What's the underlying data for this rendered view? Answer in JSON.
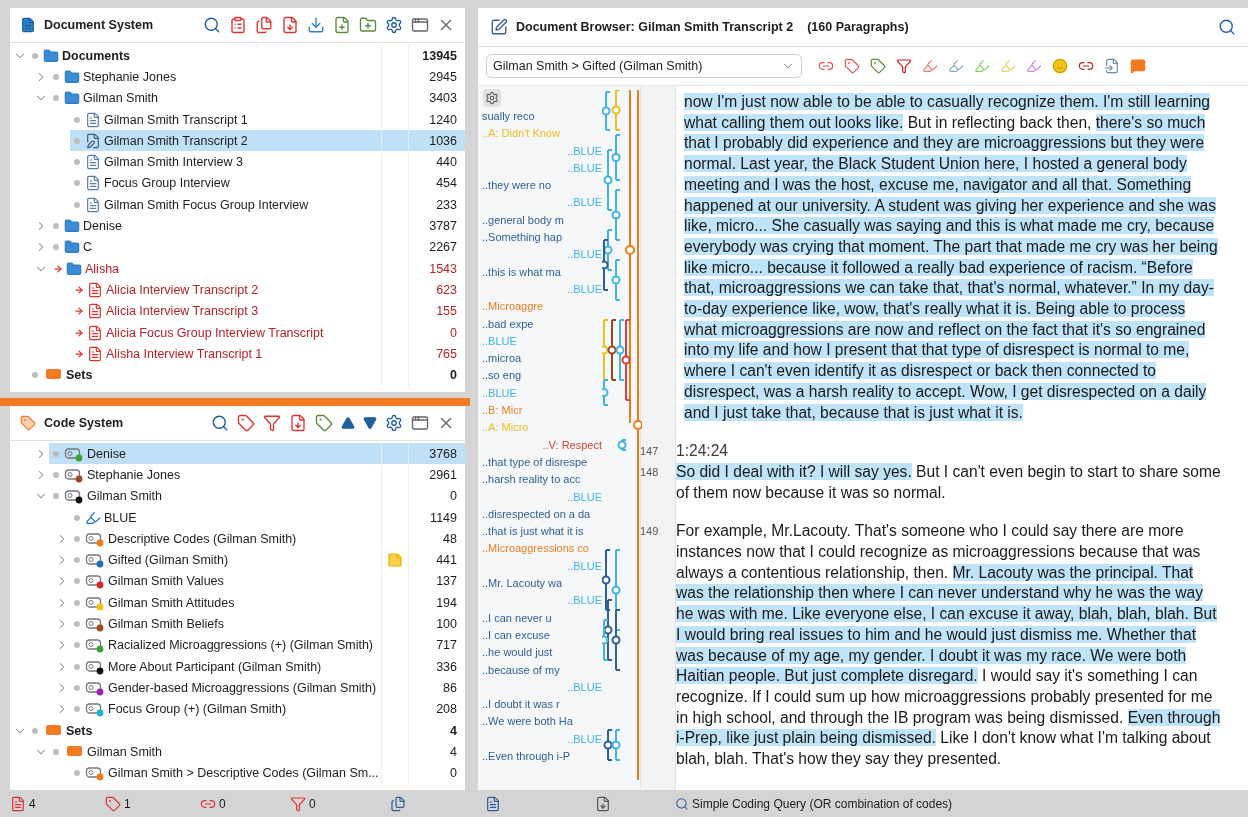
{
  "document_system": {
    "title": "Document System",
    "tree": [
      {
        "label": "Documents",
        "kind": "folder",
        "count": "13945",
        "expanded": true,
        "selected": false,
        "flagged": false,
        "children": [
          {
            "label": "Stephanie Jones",
            "kind": "folder",
            "count": "2945",
            "expanded": false,
            "selected": false,
            "flagged": false
          },
          {
            "label": "Gilman Smith",
            "kind": "folder",
            "count": "3403",
            "expanded": true,
            "selected": false,
            "flagged": false,
            "children": [
              {
                "label": "Gilman Smith Transcript 1",
                "kind": "document",
                "count": "1240",
                "selected": false,
                "flagged": false
              },
              {
                "label": "Gilman Smith Transcript 2",
                "kind": "open-document",
                "count": "1036",
                "selected": true,
                "flagged": false
              },
              {
                "label": "Gilman Smith Interview 3",
                "kind": "document",
                "count": "440",
                "selected": false,
                "flagged": false
              },
              {
                "label": "Focus Group Interview",
                "kind": "document",
                "count": "454",
                "selected": false,
                "flagged": false
              },
              {
                "label": "Gilman Smith Focus Group Interview",
                "kind": "document",
                "count": "233",
                "selected": false,
                "flagged": false
              }
            ]
          },
          {
            "label": "Denise",
            "kind": "folder",
            "count": "3787",
            "expanded": false,
            "selected": false,
            "flagged": false
          },
          {
            "label": "C",
            "kind": "folder",
            "count": "2267",
            "expanded": false,
            "selected": false,
            "flagged": false
          },
          {
            "label": "Alisha",
            "kind": "folder",
            "count": "1543",
            "expanded": true,
            "selected": false,
            "flagged": true,
            "children": [
              {
                "label": "Alicia Interview Transcript 2",
                "kind": "document",
                "count": "623",
                "selected": false,
                "flagged": true
              },
              {
                "label": "Alicia Interview Transcript 3",
                "kind": "document",
                "count": "155",
                "selected": false,
                "flagged": true
              },
              {
                "label": "Alicia Focus Group Interview Transcript",
                "kind": "document",
                "count": "0",
                "selected": false,
                "flagged": true
              },
              {
                "label": "Alisha Interview Transcript 1",
                "kind": "document",
                "count": "765",
                "selected": false,
                "flagged": true
              }
            ]
          }
        ]
      },
      {
        "label": "Sets",
        "kind": "set",
        "count": "0",
        "selected": false,
        "flagged": false
      }
    ]
  },
  "code_system": {
    "title": "Code System",
    "codes": [
      {
        "label": "Denise",
        "kind": "code",
        "color": "#3aa335",
        "count": "3768",
        "expanded": false,
        "selected": true,
        "memo": false
      },
      {
        "label": "Stephanie Jones",
        "kind": "code",
        "color": "#9a4a1c",
        "count": "2961",
        "expanded": false,
        "selected": false,
        "memo": false
      },
      {
        "label": "Gilman Smith",
        "kind": "code",
        "color": "#111111",
        "count": "0",
        "expanded": true,
        "selected": false,
        "memo": false,
        "children": [
          {
            "label": "BLUE",
            "kind": "highlight",
            "count": "1149",
            "selected": false,
            "memo": false
          },
          {
            "label": "Descriptive Codes (Gilman Smith)",
            "kind": "code",
            "color": "#f07a1a",
            "count": "48",
            "expanded": false,
            "selected": false,
            "memo": false
          },
          {
            "label": "Gifted (Gilman Smith)",
            "kind": "code",
            "color": "#1f6fc0",
            "count": "441",
            "expanded": false,
            "selected": false,
            "memo": true
          },
          {
            "label": "Gilman Smith Values",
            "kind": "code",
            "color": "#e02424",
            "count": "137",
            "expanded": false,
            "selected": false,
            "memo": false
          },
          {
            "label": "Gilman Smith Attitudes",
            "kind": "code",
            "color": "#f2c40f",
            "count": "194",
            "expanded": false,
            "selected": false,
            "memo": false
          },
          {
            "label": "Gilman Smith Beliefs",
            "kind": "code",
            "color": "#9a4a1c",
            "count": "100",
            "expanded": false,
            "selected": false,
            "memo": false
          },
          {
            "label": "Racialized Microaggressions (+) (Gilman Smith)",
            "kind": "code",
            "color": "#3aa335",
            "count": "717",
            "expanded": false,
            "selected": false,
            "memo": false
          },
          {
            "label": "More About Participant (Gilman Smith)",
            "kind": "code",
            "color": "#111111",
            "count": "336",
            "expanded": false,
            "selected": false,
            "memo": false
          },
          {
            "label": "Gender-based Microaggressions (Gilman Smith)",
            "kind": "code",
            "color": "#a020b0",
            "count": "86",
            "expanded": false,
            "selected": false,
            "memo": false
          },
          {
            "label": "Focus Group (+) (Gilman Smith)",
            "kind": "code",
            "color": "#18b8c8",
            "count": "208",
            "expanded": false,
            "selected": false,
            "memo": false
          }
        ]
      }
    ],
    "sets": [
      {
        "label": "Sets",
        "kind": "set",
        "count": "4",
        "expanded": true,
        "selected": false,
        "memo": false,
        "children": [
          {
            "label": "Gilman Smith",
            "kind": "set",
            "count": "4",
            "expanded": true,
            "selected": false,
            "memo": false,
            "children": [
              {
                "label": "Gilman Smith > Descriptive Codes (Gilman Sm...",
                "kind": "code",
                "color": "#f07a1a",
                "count": "0",
                "selected": false,
                "memo": false
              }
            ]
          }
        ]
      }
    ]
  },
  "document_browser": {
    "title": "Document Browser: Gilman Smith Transcript 2",
    "paragraph_count": "(160 Paragraphs)",
    "code_filter": "Gilman Smith > Gifted (Gilman Smith)",
    "stripe_labels": [
      {
        "text": "sually reco",
        "kind": "segment",
        "color": "#2f5f96"
      },
      {
        "text": "..A: Didn't Know",
        "kind": "segment",
        "color": "#e8c020"
      },
      {
        "text": "..BLUE",
        "kind": "code",
        "color": "#41b4e6"
      },
      {
        "text": "..BLUE",
        "kind": "code",
        "color": "#41b4e6"
      },
      {
        "text": "..they were no",
        "kind": "segment",
        "color": "#2f5f96"
      },
      {
        "text": "..BLUE",
        "kind": "code",
        "color": "#41b4e6"
      },
      {
        "text": "..general body m",
        "kind": "segment",
        "color": "#2f5f96"
      },
      {
        "text": "..Something hap",
        "kind": "segment",
        "color": "#2f5f96"
      },
      {
        "text": "..BLUE",
        "kind": "code",
        "color": "#41b4e6"
      },
      {
        "text": "..this is what ma",
        "kind": "segment",
        "color": "#2f5f96"
      },
      {
        "text": "..BLUE",
        "kind": "code",
        "color": "#41b4e6"
      },
      {
        "text": "..Microaggre",
        "kind": "segment",
        "color": "#e67e22"
      },
      {
        "text": "..bad expe",
        "kind": "segment",
        "color": "#2f5f96"
      },
      {
        "text": "..BLUE",
        "kind": "segment",
        "color": "#41b4e6"
      },
      {
        "text": "..microa",
        "kind": "segment",
        "color": "#2f5f96"
      },
      {
        "text": "..so eng",
        "kind": "segment",
        "color": "#2f5f96"
      },
      {
        "text": "..BLUE",
        "kind": "segment",
        "color": "#41b4e6"
      },
      {
        "text": "..B: Micr",
        "kind": "segment",
        "color": "#e67e22"
      },
      {
        "text": "..A: Micro",
        "kind": "segment",
        "color": "#e8c020"
      },
      {
        "text": "..V: Respect",
        "kind": "code",
        "color": "#d0453a"
      },
      {
        "text": "..that type of disrespe",
        "kind": "segment",
        "color": "#2f5f96"
      },
      {
        "text": "..harsh reality to acc",
        "kind": "segment",
        "color": "#2f5f96"
      },
      {
        "text": "..BLUE",
        "kind": "code",
        "color": "#41b4e6"
      },
      {
        "text": "..disrespected on a da",
        "kind": "segment",
        "color": "#2f5f96"
      },
      {
        "text": "..that is just what it is",
        "kind": "segment",
        "color": "#2f5f96"
      },
      {
        "text": "..Microaggressions co",
        "kind": "segment",
        "color": "#e67e22"
      },
      {
        "text": "..BLUE",
        "kind": "code",
        "color": "#41b4e6"
      },
      {
        "text": "..Mr. Lacouty wa",
        "kind": "segment",
        "color": "#2f5f96"
      },
      {
        "text": "..BLUE",
        "kind": "code",
        "color": "#41b4e6"
      },
      {
        "text": "..I can never u",
        "kind": "segment",
        "color": "#2f5f96"
      },
      {
        "text": "..I can excuse",
        "kind": "segment",
        "color": "#2f5f96"
      },
      {
        "text": "..he would just",
        "kind": "segment",
        "color": "#2f5f96"
      },
      {
        "text": "..because of my",
        "kind": "segment",
        "color": "#2f5f96"
      },
      {
        "text": "..BLUE",
        "kind": "code",
        "color": "#41b4e6"
      },
      {
        "text": "..I doubt it was r",
        "kind": "segment",
        "color": "#2f5f96"
      },
      {
        "text": "..We were both Ha",
        "kind": "segment",
        "color": "#2f5f96"
      },
      {
        "text": "..BLUE",
        "kind": "code",
        "color": "#41b4e6"
      },
      {
        "text": "..Even through i-P",
        "kind": "segment",
        "color": "#2f5f96"
      }
    ],
    "paragraphs": [
      {
        "kind": "text",
        "segments": [
          {
            "text": "now I'm just now able to be able to casually recognize them. I'm still learning what calling them out looks like.",
            "coded": true
          },
          {
            "text": " But in reflecting back then, ",
            "coded": false
          },
          {
            "text": "there's so much that I probably did experience and they are microaggressions but they were normal. Last year, the Black Student Union here, I hosted a general body meeting and I was the host, excuse me, navigator and all that. Something happened at our university. A student was giving her experience",
            "coded": true
          },
          {
            "text": " and she was like, micro... She casually was saying and this is what made me cry, because everybody was crying that moment.",
            "coded": true
          },
          {
            "text": " The part that made me cry was her being like micro... because it followed a really bad experience of racism. “Before that, microaggressions we can take that, that's normal, whatever.” In my day-to-day experience like, wow, that's really what it is. Being able to process what microaggressions are now and reflect on the fact that it's so engrained into my life and how I present that that type of disrespect is normal to me, where I can't even identify it as disrespect or back then connected to disrespect, was a harsh reality to accept.  Wow, I get disrespected on a daily and I just take that, because that is just what it is.",
            "coded": true
          }
        ]
      },
      {
        "kind": "timestamp",
        "number": "147",
        "text": "1:24:24"
      },
      {
        "kind": "text",
        "number": "148",
        "segments": [
          {
            "text": "So did I deal with it? I will say yes.",
            "coded": true
          },
          {
            "text": " But I can't even begin to start to share some of them now because it was so normal.",
            "coded": false
          }
        ]
      },
      {
        "kind": "text",
        "number": "149",
        "segments": [
          {
            "text": "For example, Mr.Lacouty. That's someone who I could say there are more instances now that I could recognize as microaggressions because that was always a contentious relationship, then. ",
            "coded": false
          },
          {
            "text": "Mr. Lacouty was the principal. That was the relationship then where I can never understand why he was the way he was with me. Like everyone else, I can excuse it away, blah, blah, blah. But I would bring real issues to him and he would just dismiss me. Whether that was because of my age, my gender. I doubt it was my race. We were both Haitian people. But just complete disregard.",
            "coded": true
          },
          {
            "text": " I would say it's something I can recognize. If I could sum up how microaggressions probably presented for me in high school, and through the IB program was being dismissed. ",
            "coded": false
          },
          {
            "text": "Even through i-Prep, like just plain being dismissed.",
            "coded": true
          },
          {
            "text": " Like I don't know what I'm talking about blah, blah. That's how they say they presented.",
            "coded": false
          }
        ]
      }
    ]
  },
  "status_bar": {
    "counts": [
      {
        "kind": "documents",
        "text": "4"
      },
      {
        "kind": "codes",
        "text": "1"
      },
      {
        "kind": "codings",
        "text": "0"
      },
      {
        "kind": "weighted",
        "text": "0"
      }
    ],
    "query": "Simple Coding Query (OR combination of codes)"
  }
}
